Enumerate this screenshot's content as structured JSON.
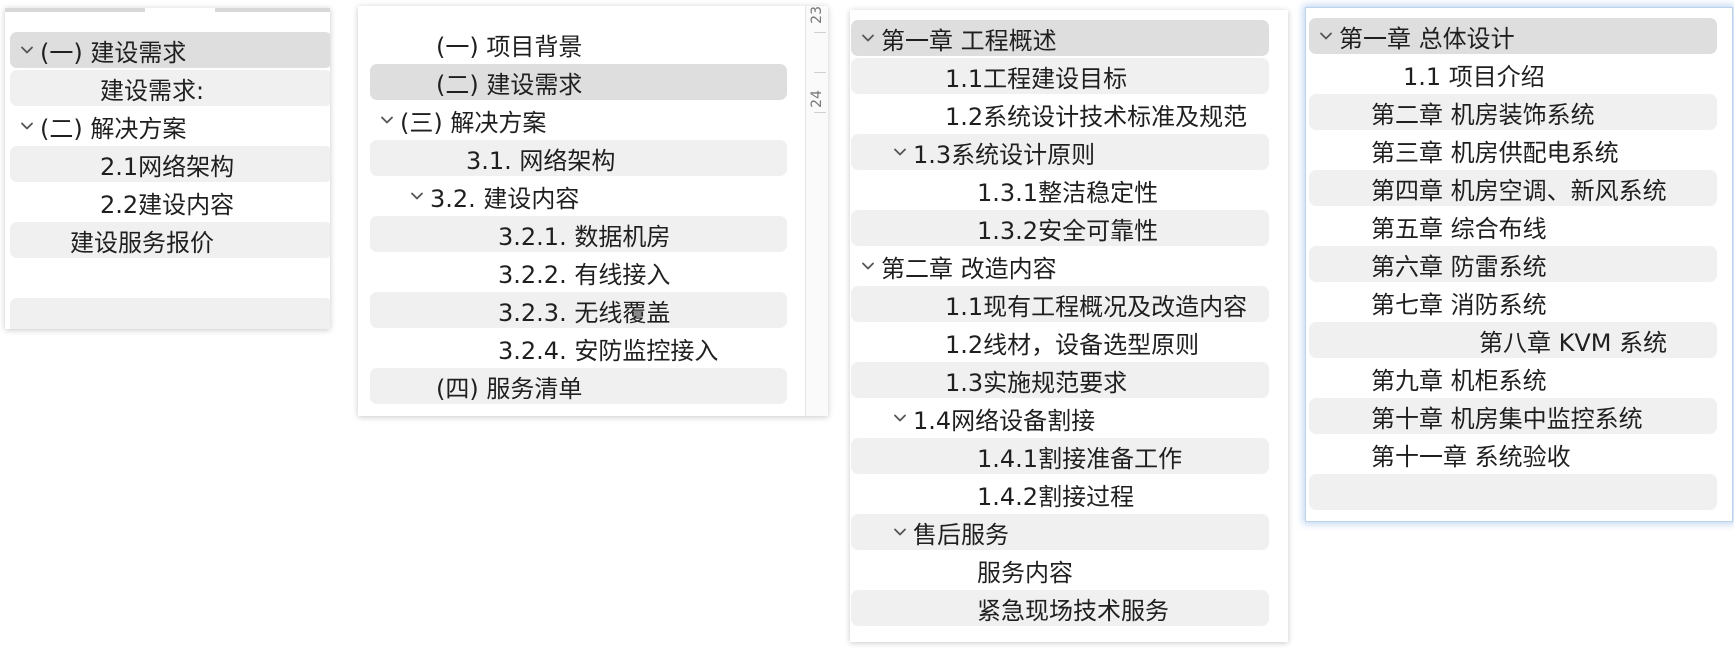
{
  "panel1": {
    "items": [
      {
        "label": "(一) 建设需求"
      },
      {
        "label": "建设需求:"
      },
      {
        "label": "(二) 解决方案"
      },
      {
        "label": "2.1网络架构"
      },
      {
        "label": "2.2建设内容"
      },
      {
        "label": "建设服务报价"
      }
    ]
  },
  "panel2": {
    "ruler": [
      "23",
      "24"
    ],
    "items": [
      {
        "label": "(一) 项目背景"
      },
      {
        "label": "(二) 建设需求"
      },
      {
        "label": "(三) 解决方案"
      },
      {
        "label": "3.1. 网络架构"
      },
      {
        "label": "3.2. 建设内容"
      },
      {
        "label": "3.2.1. 数据机房"
      },
      {
        "label": "3.2.2. 有线接入"
      },
      {
        "label": "3.2.3. 无线覆盖"
      },
      {
        "label": "3.2.4. 安防监控接入"
      },
      {
        "label": "(四) 服务清单"
      }
    ]
  },
  "panel3": {
    "items": [
      {
        "label": "第一章 工程概述"
      },
      {
        "label": "1.1工程建设目标"
      },
      {
        "label": "1.2系统设计技术标准及规范"
      },
      {
        "label": "1.3系统设计原则"
      },
      {
        "label": "1.3.1整洁稳定性"
      },
      {
        "label": "1.3.2安全可靠性"
      },
      {
        "label": "第二章 改造内容"
      },
      {
        "label": "1.1现有工程概况及改造内容"
      },
      {
        "label": "1.2线材，设备选型原则"
      },
      {
        "label": "1.3实施规范要求"
      },
      {
        "label": "1.4网络设备割接"
      },
      {
        "label": "1.4.1割接准备工作"
      },
      {
        "label": "1.4.2割接过程"
      },
      {
        "label": "售后服务"
      },
      {
        "label": "服务内容"
      },
      {
        "label": "紧急现场技术服务"
      }
    ]
  },
  "panel4": {
    "items": [
      {
        "label": "第一章  总体设计"
      },
      {
        "label": "1.1 项目介绍"
      },
      {
        "label": "第二章 机房装饰系统"
      },
      {
        "label": "第三章 机房供配电系统"
      },
      {
        "label": "第四章 机房空调、新风系统"
      },
      {
        "label": "第五章 综合布线"
      },
      {
        "label": "第六章 防雷系统"
      },
      {
        "label": "第七章 消防系统"
      },
      {
        "label": "第八章 KVM 系统"
      },
      {
        "label": "第九章 机柜系统"
      },
      {
        "label": "第十章 机房集中监控系统"
      },
      {
        "label": "第十一章 系统验收"
      }
    ]
  },
  "colors": {
    "row_alt": "#f0f0f0",
    "row_selected": "#dedede",
    "focus_ring": "#bcd3ee",
    "text": "#1f1f1f",
    "chevron": "#555555"
  },
  "icons": {
    "expand": "chevron-down-icon"
  }
}
